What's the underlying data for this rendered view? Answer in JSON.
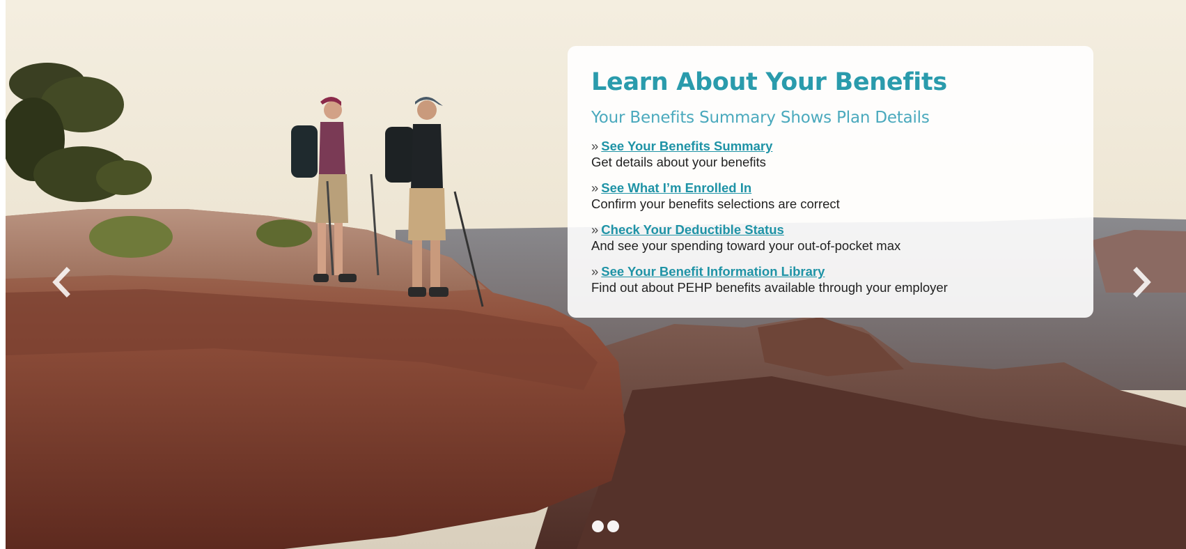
{
  "slide": {
    "heading": "Learn About Your Benefits",
    "subheading": "Your Benefits Summary Shows Plan Details",
    "bullet": "»",
    "items": [
      {
        "link": "See Your Benefits Summary",
        "desc": "Get details about your benefits"
      },
      {
        "link": "See What I’m Enrolled In",
        "desc": "Confirm your benefits selections are correct"
      },
      {
        "link": "Check Your Deductible Status",
        "desc": "And see your spending toward your out-of-pocket max"
      },
      {
        "link": "See Your Benefit Information Library",
        "desc": "Find out about PEHP benefits available through your employer"
      }
    ]
  },
  "carousel": {
    "prev_icon": "chevron-left-icon",
    "next_icon": "chevron-right-icon",
    "slide_count": 2
  },
  "colors": {
    "heading": "#2a9bac",
    "subheading": "#4aa9bd",
    "link": "#1f93a6"
  }
}
